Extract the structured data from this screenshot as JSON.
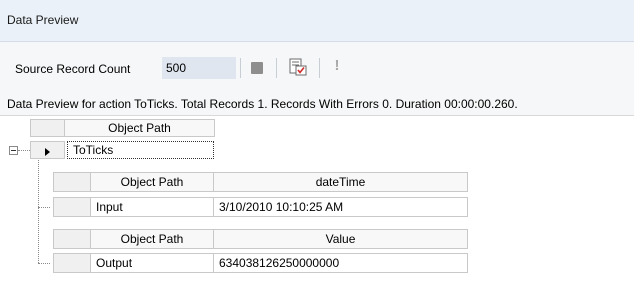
{
  "panel": {
    "title": "Data Preview"
  },
  "toolbar": {
    "count_label": "Source Record Count",
    "count_value": "500",
    "icons": [
      "stop-icon",
      "form-check-icon",
      "exclamation-icon"
    ]
  },
  "status": {
    "text": "Data Preview for action ToTicks. Total Records 1. Records With Errors 0. Duration 00:00:00.260."
  },
  "grid": {
    "top_header": "Object Path",
    "top_row_value": "ToTicks",
    "input_table": {
      "headers": [
        "Object Path",
        "dateTime"
      ],
      "row": [
        "Input",
        "3/10/2010 10:10:25 AM"
      ]
    },
    "output_table": {
      "headers": [
        "Object Path",
        "Value"
      ],
      "row": [
        "Output",
        "634038126250000000"
      ]
    }
  }
}
